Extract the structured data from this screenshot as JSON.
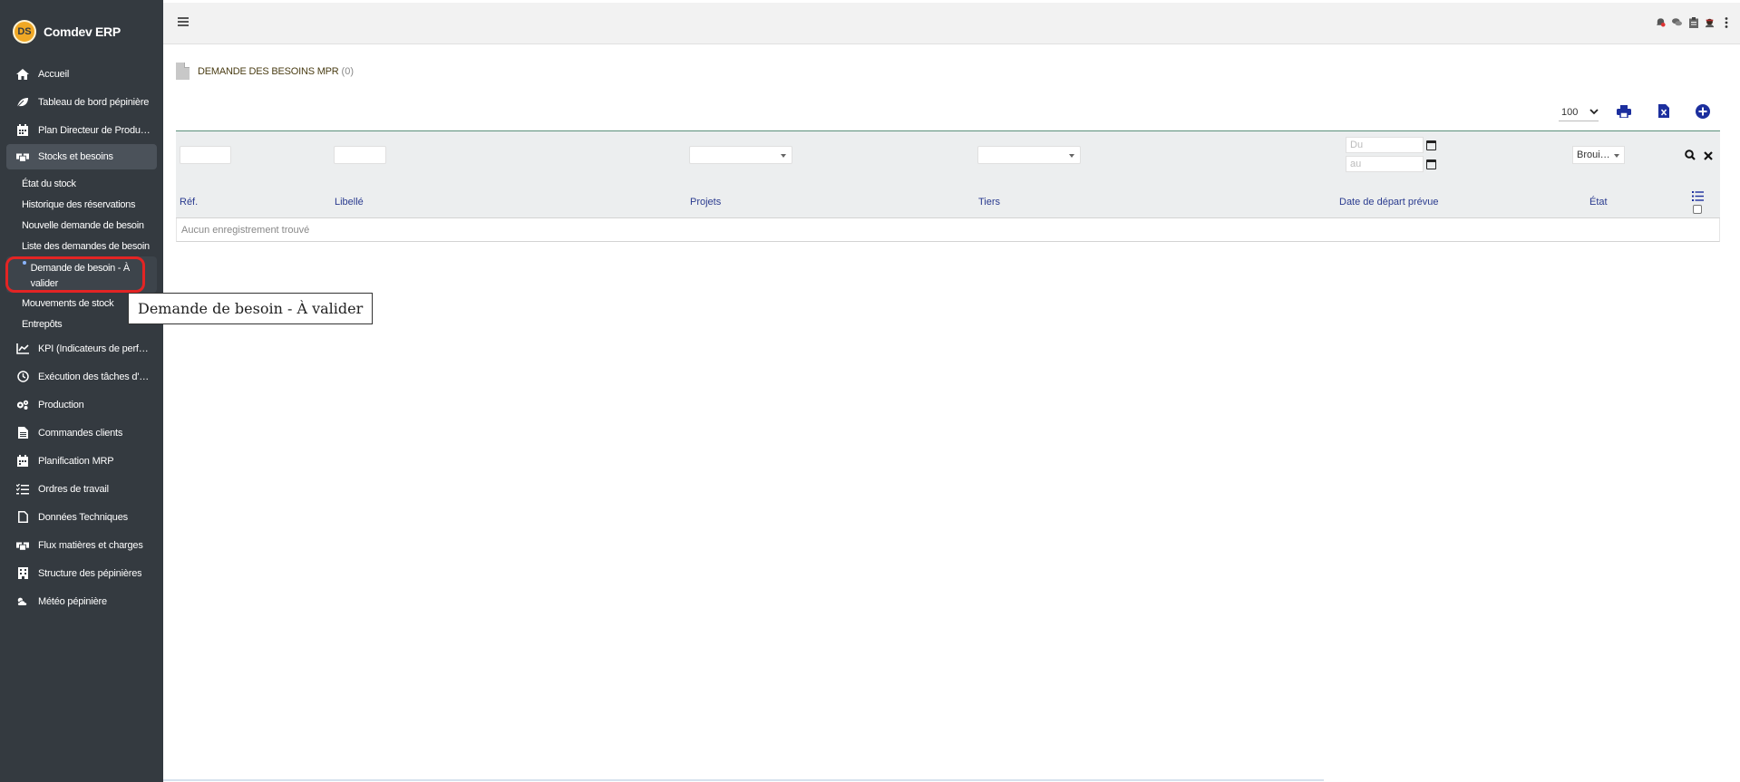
{
  "app": {
    "name": "Comdev ERP",
    "logo_text": "DS"
  },
  "sidebar": {
    "items": [
      {
        "label": "Accueil",
        "icon": "home-icon"
      },
      {
        "label": "Tableau de bord pépinière",
        "icon": "leaf-icon"
      },
      {
        "label": "Plan Directeur de Produ…",
        "icon": "calendar-icon"
      },
      {
        "label": "Stocks et besoins",
        "icon": "boxes-icon"
      }
    ],
    "sub_items": [
      {
        "label": "État du stock"
      },
      {
        "label": "Historique des réservations"
      },
      {
        "label": "Nouvelle demande de besoin"
      },
      {
        "label": "Liste des demandes de besoin"
      },
      {
        "label": "Demande de besoin - À valider"
      },
      {
        "label": "Mouvements de stock"
      },
      {
        "label": "Entrepôts"
      }
    ],
    "items_after": [
      {
        "label": "KPI (Indicateurs de perf…",
        "icon": "chart-line-icon"
      },
      {
        "label": "Exécution des tâches d'…",
        "icon": "clock-icon"
      },
      {
        "label": "Production",
        "icon": "cogs-icon"
      },
      {
        "label": "Commandes clients",
        "icon": "file-text-icon"
      },
      {
        "label": "Planification MRP",
        "icon": "calendar-icon"
      },
      {
        "label": "Ordres de travail",
        "icon": "tasks-icon"
      },
      {
        "label": "Données Techniques",
        "icon": "file-icon"
      },
      {
        "label": "Flux matières et charges",
        "icon": "boxes-icon"
      },
      {
        "label": "Structure des pépinières",
        "icon": "building-icon"
      },
      {
        "label": "Météo pépinière",
        "icon": "cloud-sun-icon"
      }
    ]
  },
  "page": {
    "title": "DEMANDE DES BESOINS MPR",
    "count": "(0)"
  },
  "toolbar": {
    "per_page": "100"
  },
  "filters": {
    "date_from_placeholder": "Du",
    "date_to_placeholder": "au",
    "etat_value": "Broui…"
  },
  "table": {
    "columns": [
      "Réf.",
      "Libellé",
      "Projets",
      "Tiers",
      "Date de départ prévue",
      "État"
    ],
    "empty_message": "Aucun enregistrement trouvé"
  },
  "tooltip": {
    "text": "Demande de besoin - À valider"
  },
  "colors": {
    "sidebar_bg": "#343a40",
    "header_text": "#2a3b8f",
    "accent": "#1c2f9e",
    "highlight": "#e32424"
  }
}
